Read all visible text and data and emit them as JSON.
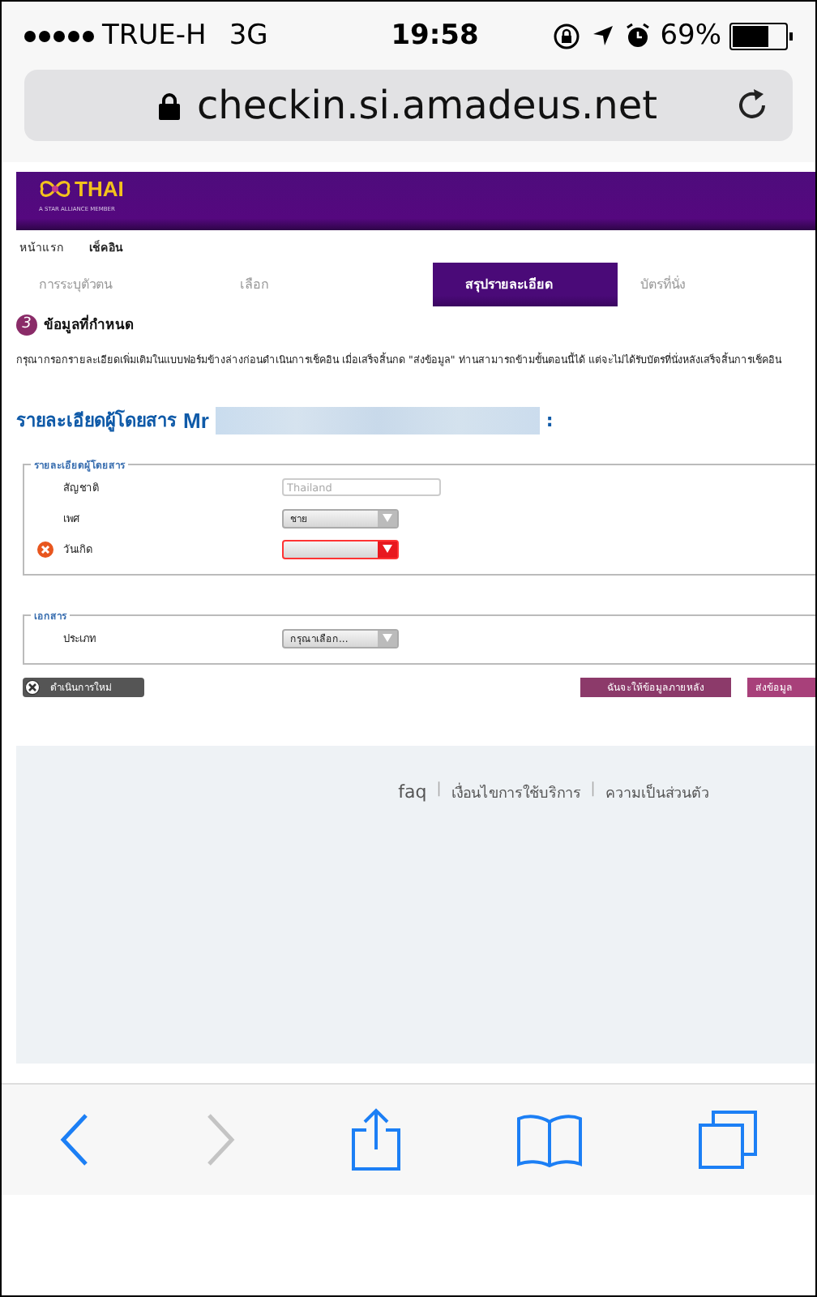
{
  "status_bar": {
    "carrier": "TRUE-H",
    "network": "3G",
    "time": "19:58",
    "battery": "69%"
  },
  "browser": {
    "url": "checkin.si.amadeus.net"
  },
  "page": {
    "logo": {
      "text": "THAI",
      "tagline": "A STAR ALLIANCE MEMBER"
    },
    "breadcrumb": [
      {
        "label": "หน้าแรก",
        "selected": false
      },
      {
        "label": "เช็คอิน",
        "selected": true
      }
    ],
    "steps": [
      {
        "label": "การระบุตัวตน",
        "selected": false
      },
      {
        "label": "เลือก",
        "selected": false
      },
      {
        "label": "สรุปรายละเอียด",
        "selected": true
      },
      {
        "label": "บัตรที่นั่ง",
        "selected": false
      }
    ],
    "section": {
      "number": "3",
      "title": "ข้อมูลที่กำหนด"
    },
    "instructions": "กรุณากรอกรายละเอียดเพิ่มเติมในแบบฟอร์มข้างล่างก่อนดำเนินการเช็คอิน เมื่อเสร็จสิ้นกด \"ส่งข้อมูล\" ท่านสามารถข้ามขั้นตอนนี้ได้ แต่จะไม่ได้รับบัตรที่นั่งหลังเสร็จสิ้นการเช็คอิน",
    "passenger_heading": {
      "label": "รายละเอียดผู้โดยสาร",
      "title": "Mr",
      "suffix": ":"
    },
    "fieldsets": [
      {
        "legend": "รายละเอียดผู้โดยสาร",
        "fields": [
          {
            "label": "สัญชาติ",
            "kind": "text",
            "placeholder": "Thailand",
            "error": false
          },
          {
            "label": "เพศ",
            "kind": "select",
            "value": "ชาย",
            "error": false
          },
          {
            "label": "วันเกิด",
            "kind": "select",
            "error": true
          }
        ]
      },
      {
        "legend": "เอกสาร",
        "fields": [
          {
            "label": "ประเภท",
            "kind": "select",
            "value": "กรุณาเลือก...",
            "error": false
          }
        ]
      }
    ],
    "buttons": [
      {
        "label": "ดำเนินการใหม่",
        "kind": "reset"
      },
      {
        "label": "ฉันจะให้ข้อมูลภายหลัง",
        "kind": "secondary"
      },
      {
        "label": "ส่งข้อมูล",
        "kind": "primary"
      }
    ],
    "footer": [
      {
        "kind": "link",
        "label": "faq"
      },
      {
        "kind": "separator",
        "label": "|"
      },
      {
        "kind": "link",
        "label": "เงื่อนไขการใช้บริการ"
      },
      {
        "kind": "separator",
        "label": "|"
      },
      {
        "kind": "link",
        "label": "ความเป็นส่วนตัว"
      }
    ]
  },
  "toolbar": [
    {
      "kind": "back",
      "disabled": false
    },
    {
      "kind": "forward",
      "disabled": true
    },
    {
      "kind": "share",
      "disabled": false
    },
    {
      "kind": "bookmarks",
      "disabled": false
    },
    {
      "kind": "tabs",
      "disabled": false
    }
  ]
}
